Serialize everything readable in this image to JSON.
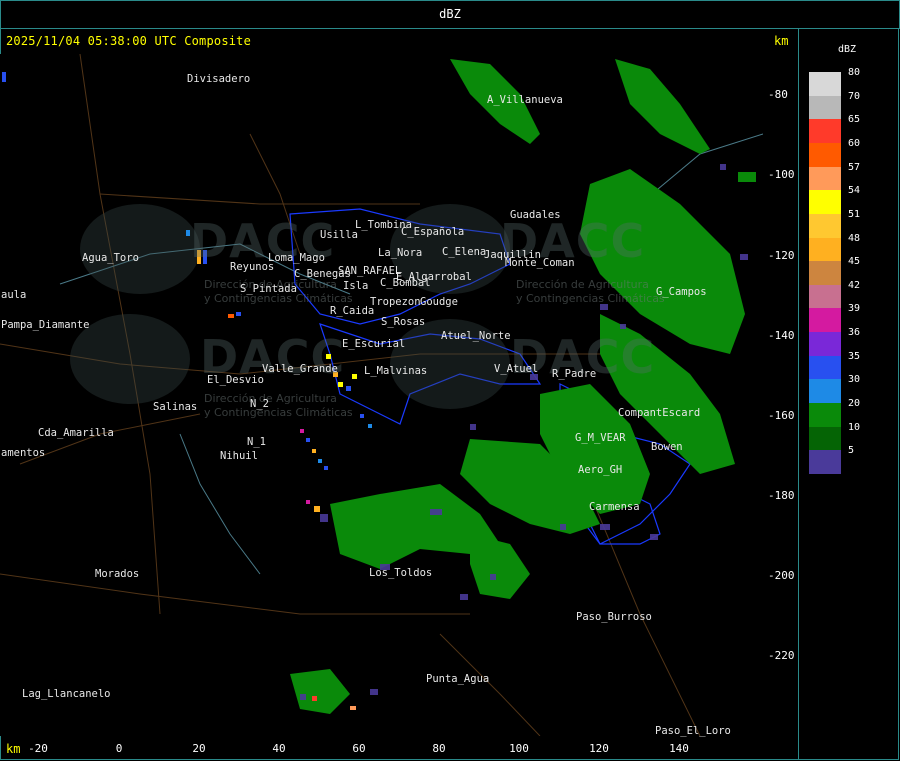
{
  "title": "dBZ",
  "header": "2025/11/04 05:38:00 UTC Composite",
  "units_top": "km",
  "units_bottom": "km",
  "legend": {
    "title": "dBZ",
    "items": [
      {
        "label": "80",
        "color": "#d8d8d8"
      },
      {
        "label": "70",
        "color": "#b8b8b8"
      },
      {
        "label": "65",
        "color": "#ff3a2a"
      },
      {
        "label": "60",
        "color": "#ff5a00"
      },
      {
        "label": "57",
        "color": "#ff9a5a"
      },
      {
        "label": "54",
        "color": "#ffff00"
      },
      {
        "label": "51",
        "color": "#ffc830"
      },
      {
        "label": "48",
        "color": "#ffb020"
      },
      {
        "label": "45",
        "color": "#cd853f"
      },
      {
        "label": "42",
        "color": "#c87090"
      },
      {
        "label": "39",
        "color": "#d41aa0"
      },
      {
        "label": "36",
        "color": "#7a28d8"
      },
      {
        "label": "35",
        "color": "#2850f0"
      },
      {
        "label": "30",
        "color": "#1e8ae6"
      },
      {
        "label": "20",
        "color": "#0a8a0a"
      },
      {
        "label": "10",
        "color": "#056405"
      },
      {
        "label": "5",
        "color": "#4a3a9a"
      }
    ]
  },
  "y_ticks": [
    "-80",
    "-100",
    "-120",
    "-140",
    "-160",
    "-180",
    "-200",
    "-220"
  ],
  "x_ticks": [
    "-20",
    "0",
    "20",
    "40",
    "60",
    "80",
    "100",
    "120",
    "140"
  ],
  "places": [
    {
      "name": "Divisadero"
    },
    {
      "name": "A_Villanueva"
    },
    {
      "name": "Guadales"
    },
    {
      "name": "Agua_Toro"
    },
    {
      "name": "Reyunos"
    },
    {
      "name": "S_Pintada"
    },
    {
      "name": "Pampa_Diamante"
    },
    {
      "name": "aula"
    },
    {
      "name": "El_Desvio"
    },
    {
      "name": "Salinas"
    },
    {
      "name": "Cda_Amarilla"
    },
    {
      "name": "amentos"
    },
    {
      "name": "Nihuil"
    },
    {
      "name": "N_1"
    },
    {
      "name": "N_2"
    },
    {
      "name": "Valle_Grande"
    },
    {
      "name": "E_Escurial"
    },
    {
      "name": "L_Malvinas"
    },
    {
      "name": "R_Caida"
    },
    {
      "name": "S_Rosas"
    },
    {
      "name": "Atuel_Norte"
    },
    {
      "name": "V_Atuel"
    },
    {
      "name": "R_Padre"
    },
    {
      "name": "G_M_VEAR"
    },
    {
      "name": "Aero_GH"
    },
    {
      "name": "Carmensa"
    },
    {
      "name": "Bowen"
    },
    {
      "name": "CompantEscard"
    },
    {
      "name": "G_Campos"
    },
    {
      "name": "Morados"
    },
    {
      "name": "Los_Toldos"
    },
    {
      "name": "Paso_Burroso"
    },
    {
      "name": "Punta_Agua"
    },
    {
      "name": "Lag_Llancanelo"
    },
    {
      "name": "Paso_El_Loro"
    },
    {
      "name": "Usilla"
    },
    {
      "name": "L_Tombina"
    },
    {
      "name": "C_Española"
    },
    {
      "name": "La_Nora"
    },
    {
      "name": "C_Bombal"
    },
    {
      "name": "SAN_RAFAEL"
    },
    {
      "name": "E_Algarrobal"
    },
    {
      "name": "C_Benegas"
    },
    {
      "name": "Isla"
    },
    {
      "name": "Tropezon"
    },
    {
      "name": "Goudge"
    },
    {
      "name": "Monte_Coman"
    },
    {
      "name": "C_Elena"
    },
    {
      "name": "Jaquillin"
    },
    {
      "name": "Loma_Mago"
    }
  ],
  "watermark": {
    "brand": "DACC",
    "line1": "Dirección de Agricultura",
    "line2": "y Contingencias Climáticas"
  },
  "colors": {
    "frame": "#2a8a8a",
    "header": "#ffff00",
    "roads": "#8b4513",
    "boundary": "#1a3aff",
    "rivers": "#5a8a9a"
  }
}
